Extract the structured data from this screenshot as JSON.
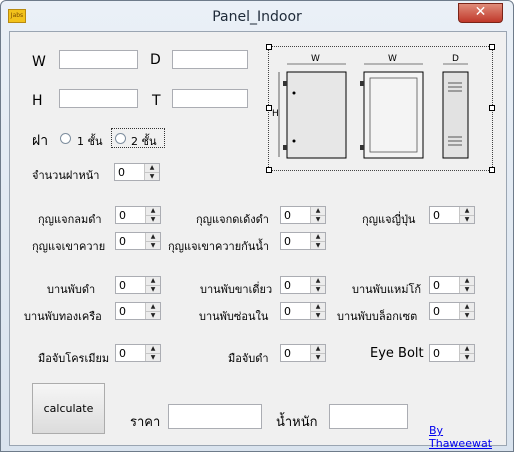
{
  "window": {
    "title": "Panel_Indoor",
    "icon_label": "Jabs",
    "close_glyph": "✕"
  },
  "dims": {
    "w": "W",
    "d": "D",
    "h": "H",
    "t": "T"
  },
  "lid": {
    "label": "ฝา",
    "option1": "1 ชั้น",
    "option2": "2 ชั้น"
  },
  "front_lid_count": {
    "label": "จำนวนฝาหน้า",
    "value": "0"
  },
  "keys": [
    {
      "label": "กุญแจกลมดำ",
      "value": "0"
    },
    {
      "label": "กุญแจกดเด้งดำ",
      "value": "0"
    },
    {
      "label": "กุญแจญี่ปุ่น",
      "value": "0"
    },
    {
      "label": "กุญแจเขาควาย",
      "value": "0"
    },
    {
      "label": "กุญแจเขาควายกันน้ำ",
      "value": "0"
    }
  ],
  "hinges": [
    {
      "label": "บานพับดำ",
      "value": "0"
    },
    {
      "label": "บานพับขาเดี่ยว",
      "value": "0"
    },
    {
      "label": "บานพับแหม่โก้",
      "value": "0"
    },
    {
      "label": "บานพับทองเครือ",
      "value": "0"
    },
    {
      "label": "บานพับซ่อนใน",
      "value": "0"
    },
    {
      "label": "บานพับบล็อกเซต",
      "value": "0"
    }
  ],
  "handles": [
    {
      "label": "มือจับโครเมียม",
      "value": "0"
    },
    {
      "label": "มือจับดำ",
      "value": "0"
    },
    {
      "label": "Eye Bolt",
      "value": "0"
    }
  ],
  "diagram": {
    "w1": "W",
    "w2": "W",
    "d": "D",
    "h": "H"
  },
  "footer": {
    "calculate": "calculate",
    "price_label": "ราคา",
    "weight_label": "น้ำหนัก",
    "credit": "By Thaweewat"
  }
}
